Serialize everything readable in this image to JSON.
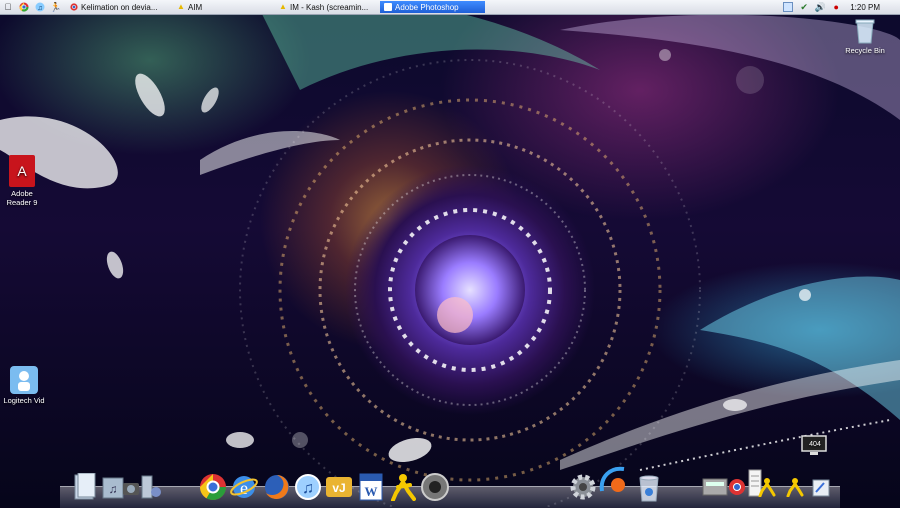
{
  "taskbar": {
    "tasks": [
      {
        "label": "Kelimation on devia...",
        "icon": "chrome-icon"
      },
      {
        "label": "AIM",
        "icon": "aim-icon"
      },
      {
        "label": "IM - Kash (screamin...",
        "icon": "aim-icon"
      },
      {
        "label": "Adobe Photoshop",
        "icon": "photoshop-icon",
        "active": true
      }
    ],
    "clock": "1:20 PM",
    "active_color": "#2f78f0"
  },
  "desktop": {
    "icons": [
      {
        "label": "Recycle Bin",
        "icon": "recycle-bin-icon"
      },
      {
        "label": "Adobe Reader 9",
        "icon": "adobe-reader-icon"
      },
      {
        "label": "Logitech Vid",
        "icon": "logitech-vid-icon"
      }
    ],
    "monitor_label": "404"
  },
  "dock": {
    "left_items": [
      "documents-icon",
      "music-folder-icon",
      "camera-icon",
      "applications-icon"
    ],
    "center_items": [
      "chrome-icon",
      "internet-explorer-icon",
      "firefox-icon",
      "itunes-icon",
      "vj-icon",
      "word-icon",
      "aim-icon",
      "media-player-icon"
    ],
    "right_items": [
      "system-preferences-icon",
      "trash-icon",
      "calculator-icon",
      "video-chat-icon",
      "chrome-icon",
      "aim-icon",
      "notes-icon"
    ]
  }
}
